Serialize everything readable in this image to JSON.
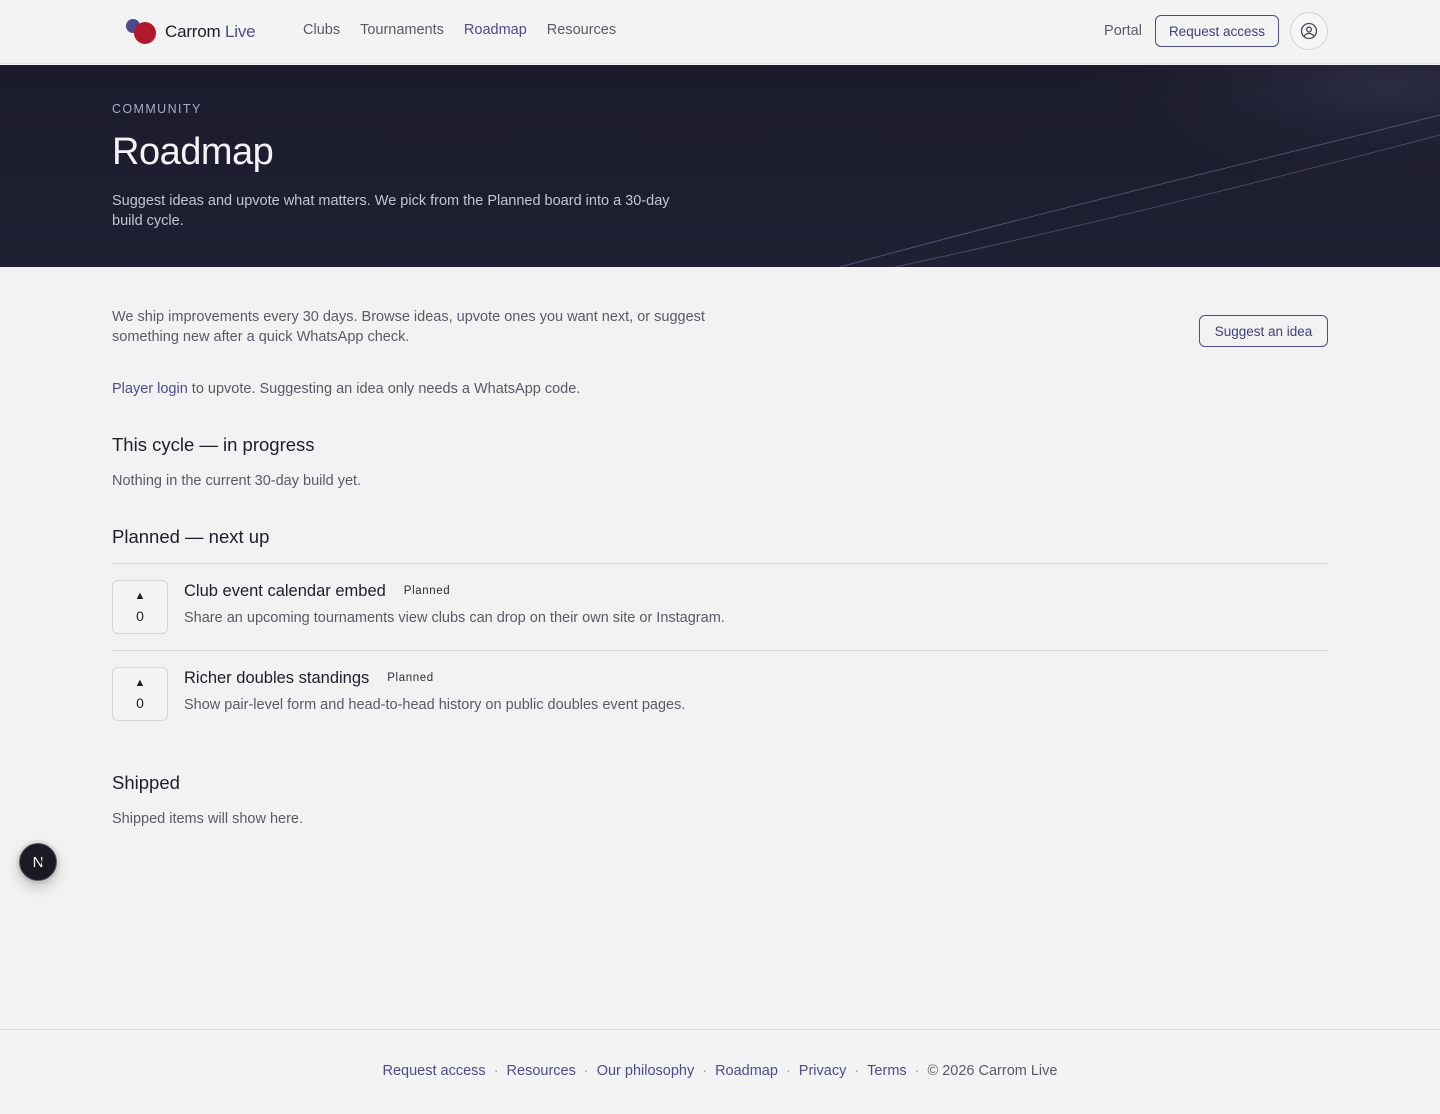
{
  "brand": {
    "name_main": "Carrom",
    "name_accent": "Live"
  },
  "nav": {
    "items": [
      {
        "label": "Clubs",
        "active": false
      },
      {
        "label": "Tournaments",
        "active": false
      },
      {
        "label": "Roadmap",
        "active": true
      },
      {
        "label": "Resources",
        "active": false
      }
    ],
    "portal": "Portal",
    "request_access": "Request access",
    "account_icon": "user-circle-icon"
  },
  "hero": {
    "eyebrow": "COMMUNITY",
    "title": "Roadmap",
    "subtitle": "Suggest ideas and upvote what matters. We pick from the Planned board into a 30-day build cycle."
  },
  "content": {
    "intro": "We ship improvements every 30 days. Browse ideas, upvote ones you want next, or suggest something new after a quick WhatsApp check.",
    "suggest_button": "Suggest an idea",
    "login_link": "Player login",
    "login_suffix": " to upvote. Suggesting an idea only needs a WhatsApp code.",
    "in_progress": {
      "title": "This cycle — in progress",
      "empty": "Nothing in the current 30-day build yet."
    },
    "planned": {
      "title": "Planned — next up",
      "items": [
        {
          "vote_arrow": "▲",
          "votes": "0",
          "title": "Club event calendar embed",
          "badge": "Planned",
          "description": "Share an upcoming tournaments view clubs can drop on their own site or Instagram."
        },
        {
          "vote_arrow": "▲",
          "votes": "0",
          "title": "Richer doubles standings",
          "badge": "Planned",
          "description": "Show pair-level form and head-to-head history on public doubles event pages."
        }
      ]
    },
    "shipped": {
      "title": "Shipped",
      "empty": "Shipped items will show here."
    }
  },
  "floating": {
    "label": "N"
  },
  "footer": {
    "links": [
      "Request access",
      "Resources",
      "Our philosophy",
      "Roadmap",
      "Privacy",
      "Terms"
    ],
    "separator": "·",
    "copyright": "© 2026 Carrom Live"
  },
  "colors": {
    "accent": "#4b4c8d",
    "brand_red": "#b2182b",
    "hero_bg": "#1a1b2c",
    "page_bg": "#f2f2f2"
  }
}
